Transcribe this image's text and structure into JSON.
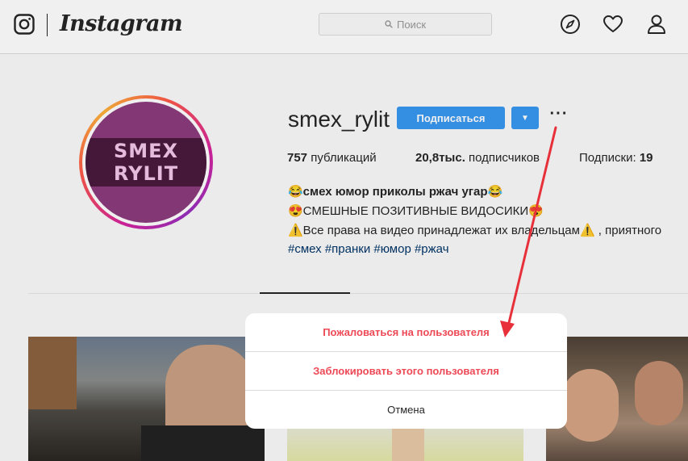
{
  "nav": {
    "brand": "Instagram",
    "search_placeholder": "Поиск",
    "icons": [
      "camera-icon",
      "compass-icon",
      "heart-icon",
      "profile-icon",
      "search-icon"
    ]
  },
  "profile": {
    "avatar_text_line1": "SMEX",
    "avatar_text_line2": "RYLIT",
    "username": "smex_rylit",
    "follow_label": "Подписаться",
    "dropdown_glyph": "▼",
    "more_glyph": "···",
    "stats": {
      "posts_value": "757",
      "posts_label": "публикаций",
      "followers_value": "20,8тыс.",
      "followers_label": "подписчиков",
      "following_label": "Подписки:",
      "following_value": "19"
    },
    "bio": {
      "line1": "😂смех юмор приколы ржач угар😂",
      "line2": "😍СМЕШНЫЕ ПОЗИТИВНЫЕ ВИДОСИКИ😍",
      "line3": "⚠️Все права на видео принадлежат их владельцам⚠️ , приятного",
      "hashtags": "#смех #пранки #юмор #ржач"
    }
  },
  "modal": {
    "report_label": "Пожаловаться на пользователя",
    "block_label": "Заблокировать этого пользователя",
    "cancel_label": "Отмена"
  },
  "colors": {
    "accent": "#3897f0",
    "danger": "#ed4956",
    "annotation_arrow": "#e8303a"
  }
}
